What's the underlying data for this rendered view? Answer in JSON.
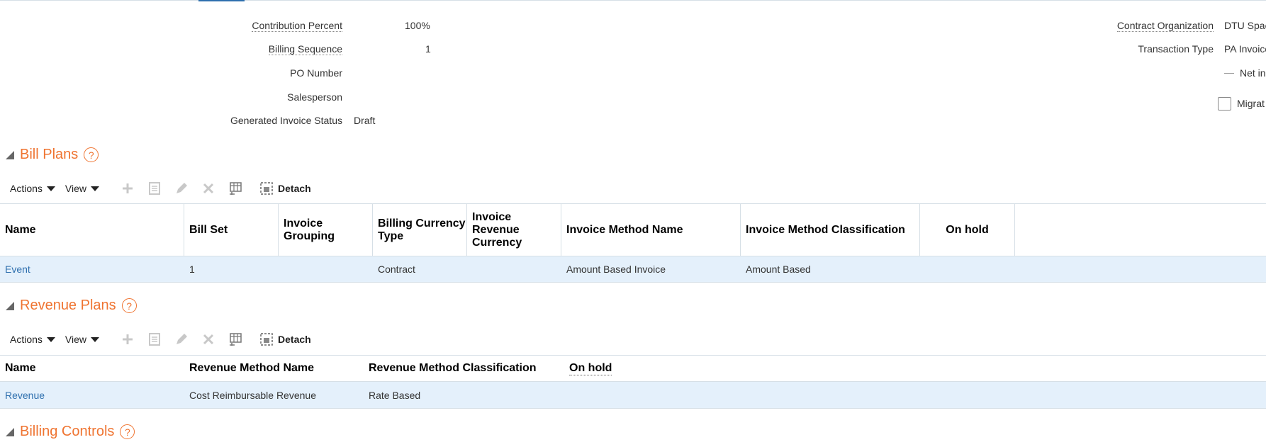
{
  "form": {
    "contribution_percent_label": "Contribution Percent",
    "contribution_percent_value": "100%",
    "billing_sequence_label": "Billing Sequence",
    "billing_sequence_value": "1",
    "po_number_label": "PO Number",
    "salesperson_label": "Salesperson",
    "generated_invoice_status_label": "Generated Invoice Status",
    "generated_invoice_status_value": "Draft",
    "contract_organization_label": "Contract Organization",
    "contract_organization_value": "DTU Spac",
    "transaction_type_label": "Transaction Type",
    "transaction_type_value": "PA Invoice",
    "net_invoice_label": "Net in",
    "migrated_label": "Migrat"
  },
  "bill_plans": {
    "title": "Bill Plans",
    "help": "?",
    "toolbar": {
      "actions": "Actions",
      "view": "View",
      "detach": "Detach"
    },
    "columns": [
      "Name",
      "Bill Set",
      "Invoice Grouping",
      "Billing Currency Type",
      "Invoice Revenue Currency",
      "Invoice Method Name",
      "Invoice Method Classification",
      "On hold"
    ],
    "rows": [
      {
        "name": "Event",
        "bill_set": "1",
        "invoice_grouping": "",
        "billing_currency_type": "Contract",
        "invoice_revenue_currency": "",
        "invoice_method_name": "Amount Based Invoice",
        "invoice_method_classification": "Amount Based",
        "on_hold": ""
      }
    ]
  },
  "revenue_plans": {
    "title": "Revenue Plans",
    "help": "?",
    "toolbar": {
      "actions": "Actions",
      "view": "View",
      "detach": "Detach"
    },
    "columns": [
      "Name",
      "Revenue Method Name",
      "Revenue Method Classification",
      "On hold"
    ],
    "rows": [
      {
        "name": "Revenue",
        "revenue_method_name": "Cost Reimbursable Revenue",
        "revenue_method_classification": "Rate Based",
        "on_hold": ""
      }
    ]
  },
  "billing_controls": {
    "title": "Billing Controls",
    "help": "?"
  },
  "colors": {
    "accent": "#ef7431",
    "link": "#2e6fae",
    "row_highlight": "#e4f0fb"
  },
  "icons": [
    "add-icon",
    "duplicate-icon",
    "edit-icon",
    "delete-icon",
    "freeze-icon",
    "detach-icon"
  ]
}
